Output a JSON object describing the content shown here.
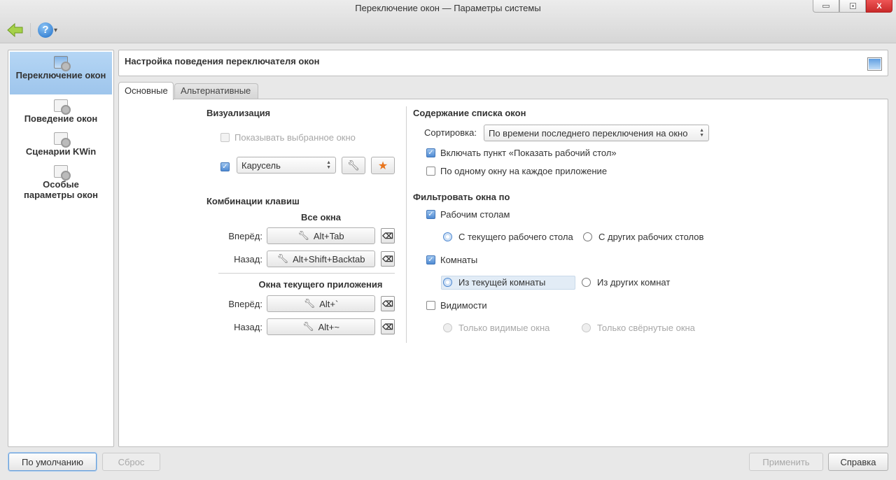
{
  "window": {
    "title": "Переключение окон — Параметры системы",
    "minimize": "_",
    "maximize": "□",
    "close": "X"
  },
  "toolbar": {
    "back_icon": "arrow-left-icon",
    "help_icon": "help-icon",
    "help_dropdown": "▾"
  },
  "sidebar": {
    "items": [
      {
        "label": "Переключение окон",
        "selected": true
      },
      {
        "label": "Поведение окон"
      },
      {
        "label": "Сценарии KWin"
      },
      {
        "label": "Особые параметры окон"
      }
    ]
  },
  "header": {
    "title": "Настройка поведения переключателя окон"
  },
  "tabs": [
    {
      "label": "Основные",
      "active": true
    },
    {
      "label": "Альтернативные"
    }
  ],
  "left": {
    "visualization": {
      "title": "Визуализация",
      "show_selected": "Показывать выбранное окно",
      "effect": "Карусель",
      "config_icon": "wrench-icon",
      "get_new_icon": "star-icon"
    },
    "shortcuts": {
      "title": "Комбинации клавиш",
      "all_windows": "Все окна",
      "current_app": "Окна текущего приложения",
      "rows": [
        {
          "label": "Вперёд:",
          "value": "Alt+Tab"
        },
        {
          "label": "Назад:",
          "value": "Alt+Shift+Backtab"
        },
        {
          "label": "Вперёд:",
          "value": "Alt+`"
        },
        {
          "label": "Назад:",
          "value": "Alt+~"
        }
      ]
    }
  },
  "right": {
    "list_title": "Содержание списка окон",
    "sort_label": "Сортировка:",
    "sort_value": "По времени последнего переключения на окно",
    "include_desktop": "Включать пункт «Показать рабочий стол»",
    "one_per_app": "По одному окну на каждое приложение",
    "filter_title": "Фильтровать окна по",
    "desktops": "Рабочим столам",
    "current_desktop": "С текущего рабочего стола",
    "other_desktops": "С других рабочих столов",
    "activities": "Комнаты",
    "current_activity": "Из текущей комнаты",
    "other_activities": "Из других комнат",
    "visibility": "Видимости",
    "only_visible": "Только видимые окна",
    "only_minimized": "Только свёрнутые окна"
  },
  "buttons": {
    "defaults": "По умолчанию",
    "reset": "Сброс",
    "apply": "Применить",
    "help": "Справка"
  }
}
